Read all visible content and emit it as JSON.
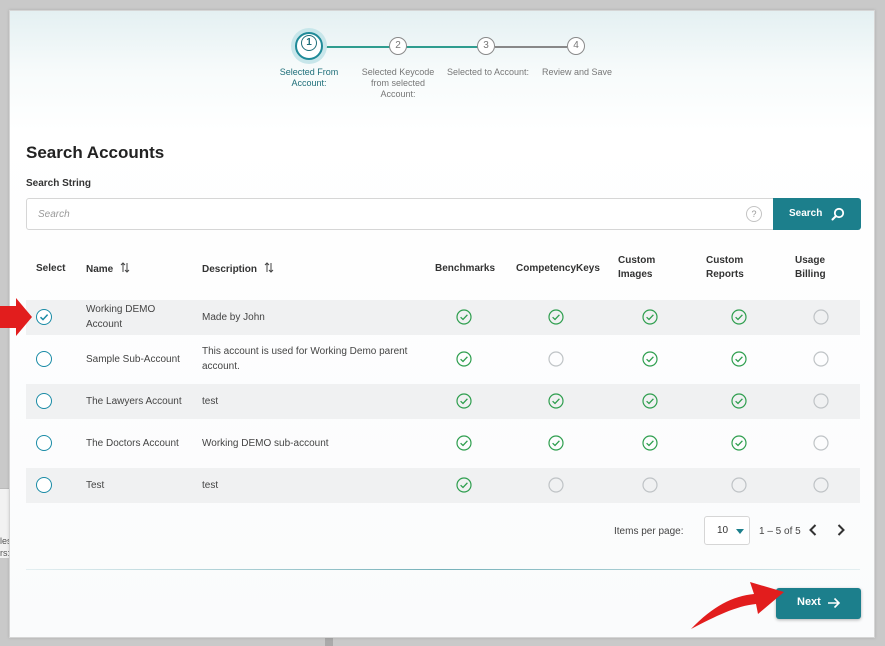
{
  "stepper": {
    "steps": [
      {
        "number": "1",
        "label": "Selected From Account:"
      },
      {
        "number": "2",
        "label": "Selected Keycode from selected Account:"
      },
      {
        "number": "3",
        "label": "Selected to Account:"
      },
      {
        "number": "4",
        "label": "Review and Save"
      }
    ],
    "active_step": 1
  },
  "page": {
    "title": "Search Accounts",
    "search_label": "Search String"
  },
  "search": {
    "placeholder": "Search",
    "value": "",
    "help_glyph": "?",
    "button_label": "Search"
  },
  "table": {
    "columns": {
      "select": "Select",
      "name": "Name",
      "description": "Description",
      "benchmarks": "Benchmarks",
      "competency_keys": "CompetencyKeys",
      "custom_images_1": "Custom",
      "custom_images_2": "Images",
      "custom_reports_1": "Custom",
      "custom_reports_2": "Reports",
      "usage_billing_1": "Usage",
      "usage_billing_2": "Billing"
    },
    "rows": [
      {
        "selected": true,
        "name_1": "Working DEMO",
        "name_2": "Account",
        "description_1": "Made by John",
        "description_2": "",
        "benchmarks": true,
        "competency_keys": true,
        "custom_images": true,
        "custom_reports": true,
        "usage_billing": false
      },
      {
        "selected": false,
        "name_1": "Sample Sub-Account",
        "name_2": "",
        "description_1": "This account is used for Working Demo parent",
        "description_2": "account.",
        "benchmarks": true,
        "competency_keys": false,
        "custom_images": true,
        "custom_reports": true,
        "usage_billing": false
      },
      {
        "selected": false,
        "name_1": "The Lawyers Account",
        "name_2": "",
        "description_1": "test",
        "description_2": "",
        "benchmarks": true,
        "competency_keys": true,
        "custom_images": true,
        "custom_reports": true,
        "usage_billing": false
      },
      {
        "selected": false,
        "name_1": "The Doctors Account",
        "name_2": "",
        "description_1": "Working DEMO sub-account",
        "description_2": "",
        "benchmarks": true,
        "competency_keys": true,
        "custom_images": true,
        "custom_reports": true,
        "usage_billing": false
      },
      {
        "selected": false,
        "name_1": "Test",
        "name_2": "",
        "description_1": "test",
        "description_2": "",
        "benchmarks": true,
        "competency_keys": false,
        "custom_images": false,
        "custom_reports": false,
        "usage_billing": false
      }
    ]
  },
  "pager": {
    "items_per_page_label": "Items per page:",
    "items_per_page_value": "10",
    "range": "1 – 5 of 5"
  },
  "footer": {
    "next_label": "Next"
  },
  "background": {
    "left_text_1": "les",
    "left_text_2": "rs:"
  },
  "colors": {
    "primary": "#1c7f8c",
    "check_green": "#2e9e4e",
    "annotation_red": "#e21d1d"
  }
}
